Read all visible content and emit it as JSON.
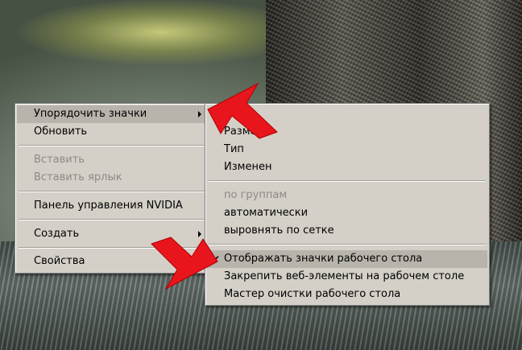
{
  "main_menu": {
    "items": [
      {
        "label": "Упорядочить значки",
        "state": "highlighted",
        "submenu": true
      },
      {
        "label": "Обновить",
        "state": "normal"
      },
      {
        "label": "Вставить",
        "state": "disabled"
      },
      {
        "label": "Вставить ярлык",
        "state": "disabled"
      },
      {
        "label": "Панель управления NVIDIA",
        "state": "normal"
      },
      {
        "label": "Создать",
        "state": "normal",
        "submenu": true
      },
      {
        "label": "Свойства",
        "state": "normal"
      }
    ]
  },
  "submenu": {
    "items": [
      {
        "label": "Размер",
        "state": "normal"
      },
      {
        "label": "Тип",
        "state": "normal"
      },
      {
        "label": "Изменен",
        "state": "normal"
      },
      {
        "label": "по группам",
        "state": "disabled"
      },
      {
        "label": "автоматически",
        "state": "normal"
      },
      {
        "label": "выровнять по сетке",
        "state": "normal"
      },
      {
        "label": "Отображать значки рабочего стола",
        "state": "highlighted",
        "checked": true
      },
      {
        "label": "Закрепить веб-элементы на рабочем столе",
        "state": "normal"
      },
      {
        "label": "Мастер очистки рабочего стола",
        "state": "normal"
      }
    ]
  },
  "check_glyph": "✔",
  "colors": {
    "menu_bg": "#d4d0c8",
    "highlight": "#b8b4ac",
    "annotation_arrow": "#e8161c"
  }
}
